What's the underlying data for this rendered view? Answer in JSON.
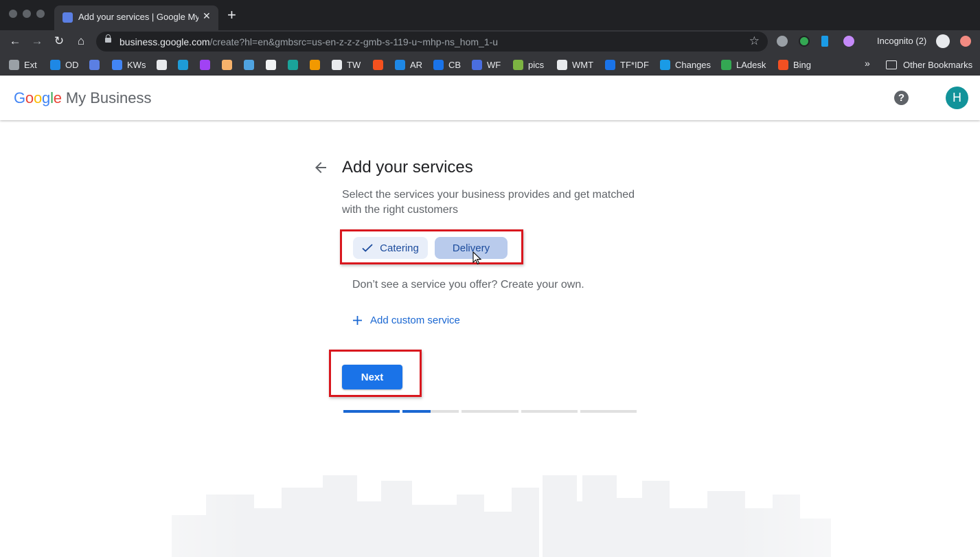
{
  "browser": {
    "tab_title": "Add your services | Google My Business",
    "new_tab_symbol": "+",
    "url_host": "business.google.com",
    "url_path": "/create?hl=en&gmbsrc=us-en-z-z-z-gmb-s-119-u~mhp-ns_hom_1-u",
    "incognito_label": "Incognito (2)",
    "bookmarks": [
      {
        "label": "Ext",
        "color": "#9aa0a6"
      },
      {
        "label": "OD",
        "color": "#1e88e5"
      },
      {
        "label": "",
        "color": "#5b7fe3"
      },
      {
        "label": "KWs",
        "color": "#4285f4"
      },
      {
        "label": "",
        "color": "#e8eaed"
      },
      {
        "label": "",
        "color": "#1e9bd7"
      },
      {
        "label": "",
        "color": "#a142f4"
      },
      {
        "label": "",
        "color": "#f6b26b"
      },
      {
        "label": "",
        "color": "#4fa3e0"
      },
      {
        "label": "",
        "color": "#f1f3f4"
      },
      {
        "label": "",
        "color": "#1aa39a"
      },
      {
        "label": "",
        "color": "#f29900"
      },
      {
        "label": "TW",
        "color": "#e8eaed"
      },
      {
        "label": "",
        "color": "#f4511e"
      },
      {
        "label": "AR",
        "color": "#1e88e5"
      },
      {
        "label": "CB",
        "color": "#1a73e8"
      },
      {
        "label": "WF",
        "color": "#4a6ee0"
      },
      {
        "label": "pics",
        "color": "#7cb342"
      },
      {
        "label": "WMT",
        "color": "#e8eaed"
      },
      {
        "label": "TF*IDF",
        "color": "#1a73e8"
      },
      {
        "label": "Changes",
        "color": "#1a9be6"
      },
      {
        "label": "LAdesk",
        "color": "#34a853"
      },
      {
        "label": "Bing",
        "color": "#f25022"
      }
    ],
    "bookmarks_overflow": "»",
    "other_bookmarks": "Other Bookmarks"
  },
  "header": {
    "logo_letters": [
      {
        "ch": "G",
        "color": "#4285f4"
      },
      {
        "ch": "o",
        "color": "#ea4335"
      },
      {
        "ch": "o",
        "color": "#fbbc05"
      },
      {
        "ch": "g",
        "color": "#4285f4"
      },
      {
        "ch": "l",
        "color": "#34a853"
      },
      {
        "ch": "e",
        "color": "#ea4335"
      }
    ],
    "logo_suffix": "My Business",
    "help_symbol": "?",
    "avatar_initial": "H"
  },
  "main": {
    "title": "Add your services",
    "subtitle": "Select the services your business provides and get matched with the right customers",
    "services": [
      {
        "label": "Catering",
        "selected": true
      },
      {
        "label": "Delivery",
        "selected": false,
        "hovered": true
      }
    ],
    "prompt": "Don’t see a service you offer? Create your own.",
    "add_custom_label": "Add custom service",
    "next_label": "Next",
    "progress": [
      {
        "fill": 1.0
      },
      {
        "fill": 0.5
      },
      {
        "fill": 0
      },
      {
        "fill": 0
      },
      {
        "fill": 0
      }
    ]
  },
  "colors": {
    "accent": "#1a73e8",
    "highlight_box": "#d9171e"
  }
}
